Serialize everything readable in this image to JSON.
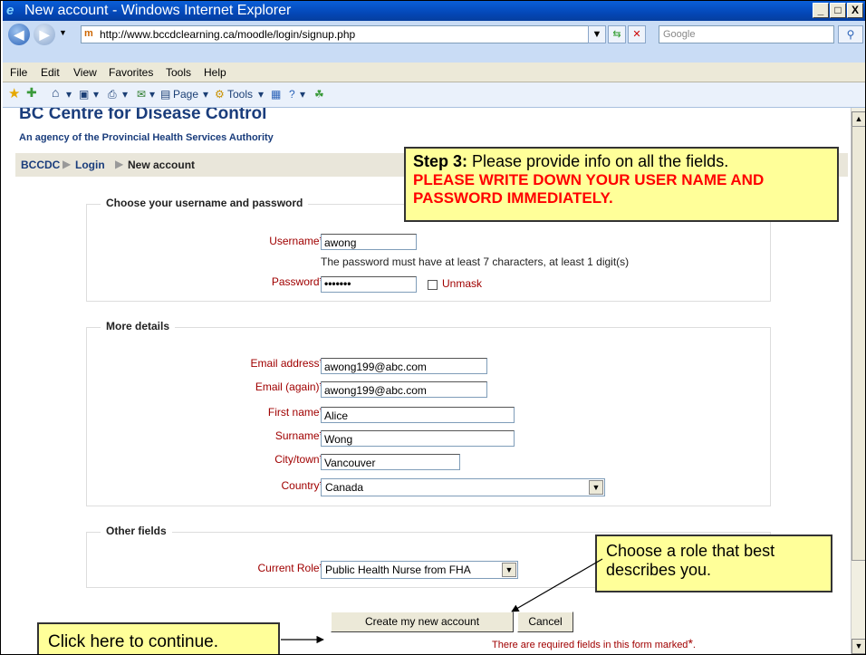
{
  "window": {
    "title": "New account - Windows Internet Explorer",
    "min_glyph": "_",
    "max_glyph": "□",
    "close_glyph": "X"
  },
  "addressbar": {
    "url": "http://www.bccdclearning.ca/moodle/login/signup.php",
    "search_placeholder": "Google"
  },
  "menu": [
    "File",
    "Edit",
    "View",
    "Favorites",
    "Tools",
    "Help"
  ],
  "commandbar": {
    "page_label": "Page",
    "tools_label": "Tools"
  },
  "site": {
    "title": "BC Centre for Disease Control",
    "subtitle": "An agency of the Provincial Health Services Authority"
  },
  "breadcrumb": [
    "BCCDC",
    "Login",
    "New account"
  ],
  "sections": {
    "credentials": {
      "legend": "Choose your username and password",
      "username_label": "Username",
      "username_value": "awong",
      "password_hint": "The password must have at least 7 characters, at least 1 digit(s)",
      "password_label": "Password",
      "password_value": "•••••••",
      "unmask_label": "Unmask"
    },
    "details": {
      "legend": "More details",
      "email_label": "Email address",
      "email_value": "awong199@abc.com",
      "email2_label": "Email (again)",
      "email2_value": "awong199@abc.com",
      "firstname_label": "First name",
      "firstname_value": "Alice",
      "surname_label": "Surname",
      "surname_value": "Wong",
      "city_label": "City/town",
      "city_value": "Vancouver",
      "country_label": "Country",
      "country_value": "Canada"
    },
    "other": {
      "legend": "Other fields",
      "role_label": "Current Role",
      "role_value": "Public Health Nurse from FHA"
    }
  },
  "required_star": "*",
  "buttons": {
    "create": "Create my new account",
    "cancel": "Cancel"
  },
  "required_note": "There are required fields in this form marked",
  "callouts": {
    "step3_bold": "Step 3:",
    "step3_text": " Please provide info on all the fields.",
    "step3_warning": "PLEASE WRITE DOWN YOUR USER NAME AND PASSWORD IMMEDIATELY.",
    "role": "Choose a role that best describes you.",
    "continue": "Click here to continue."
  },
  "colors": {
    "required": "#a00000",
    "callout_bg": "#ffff99",
    "warning": "#ff0000",
    "titlebar": "#0448b8"
  }
}
